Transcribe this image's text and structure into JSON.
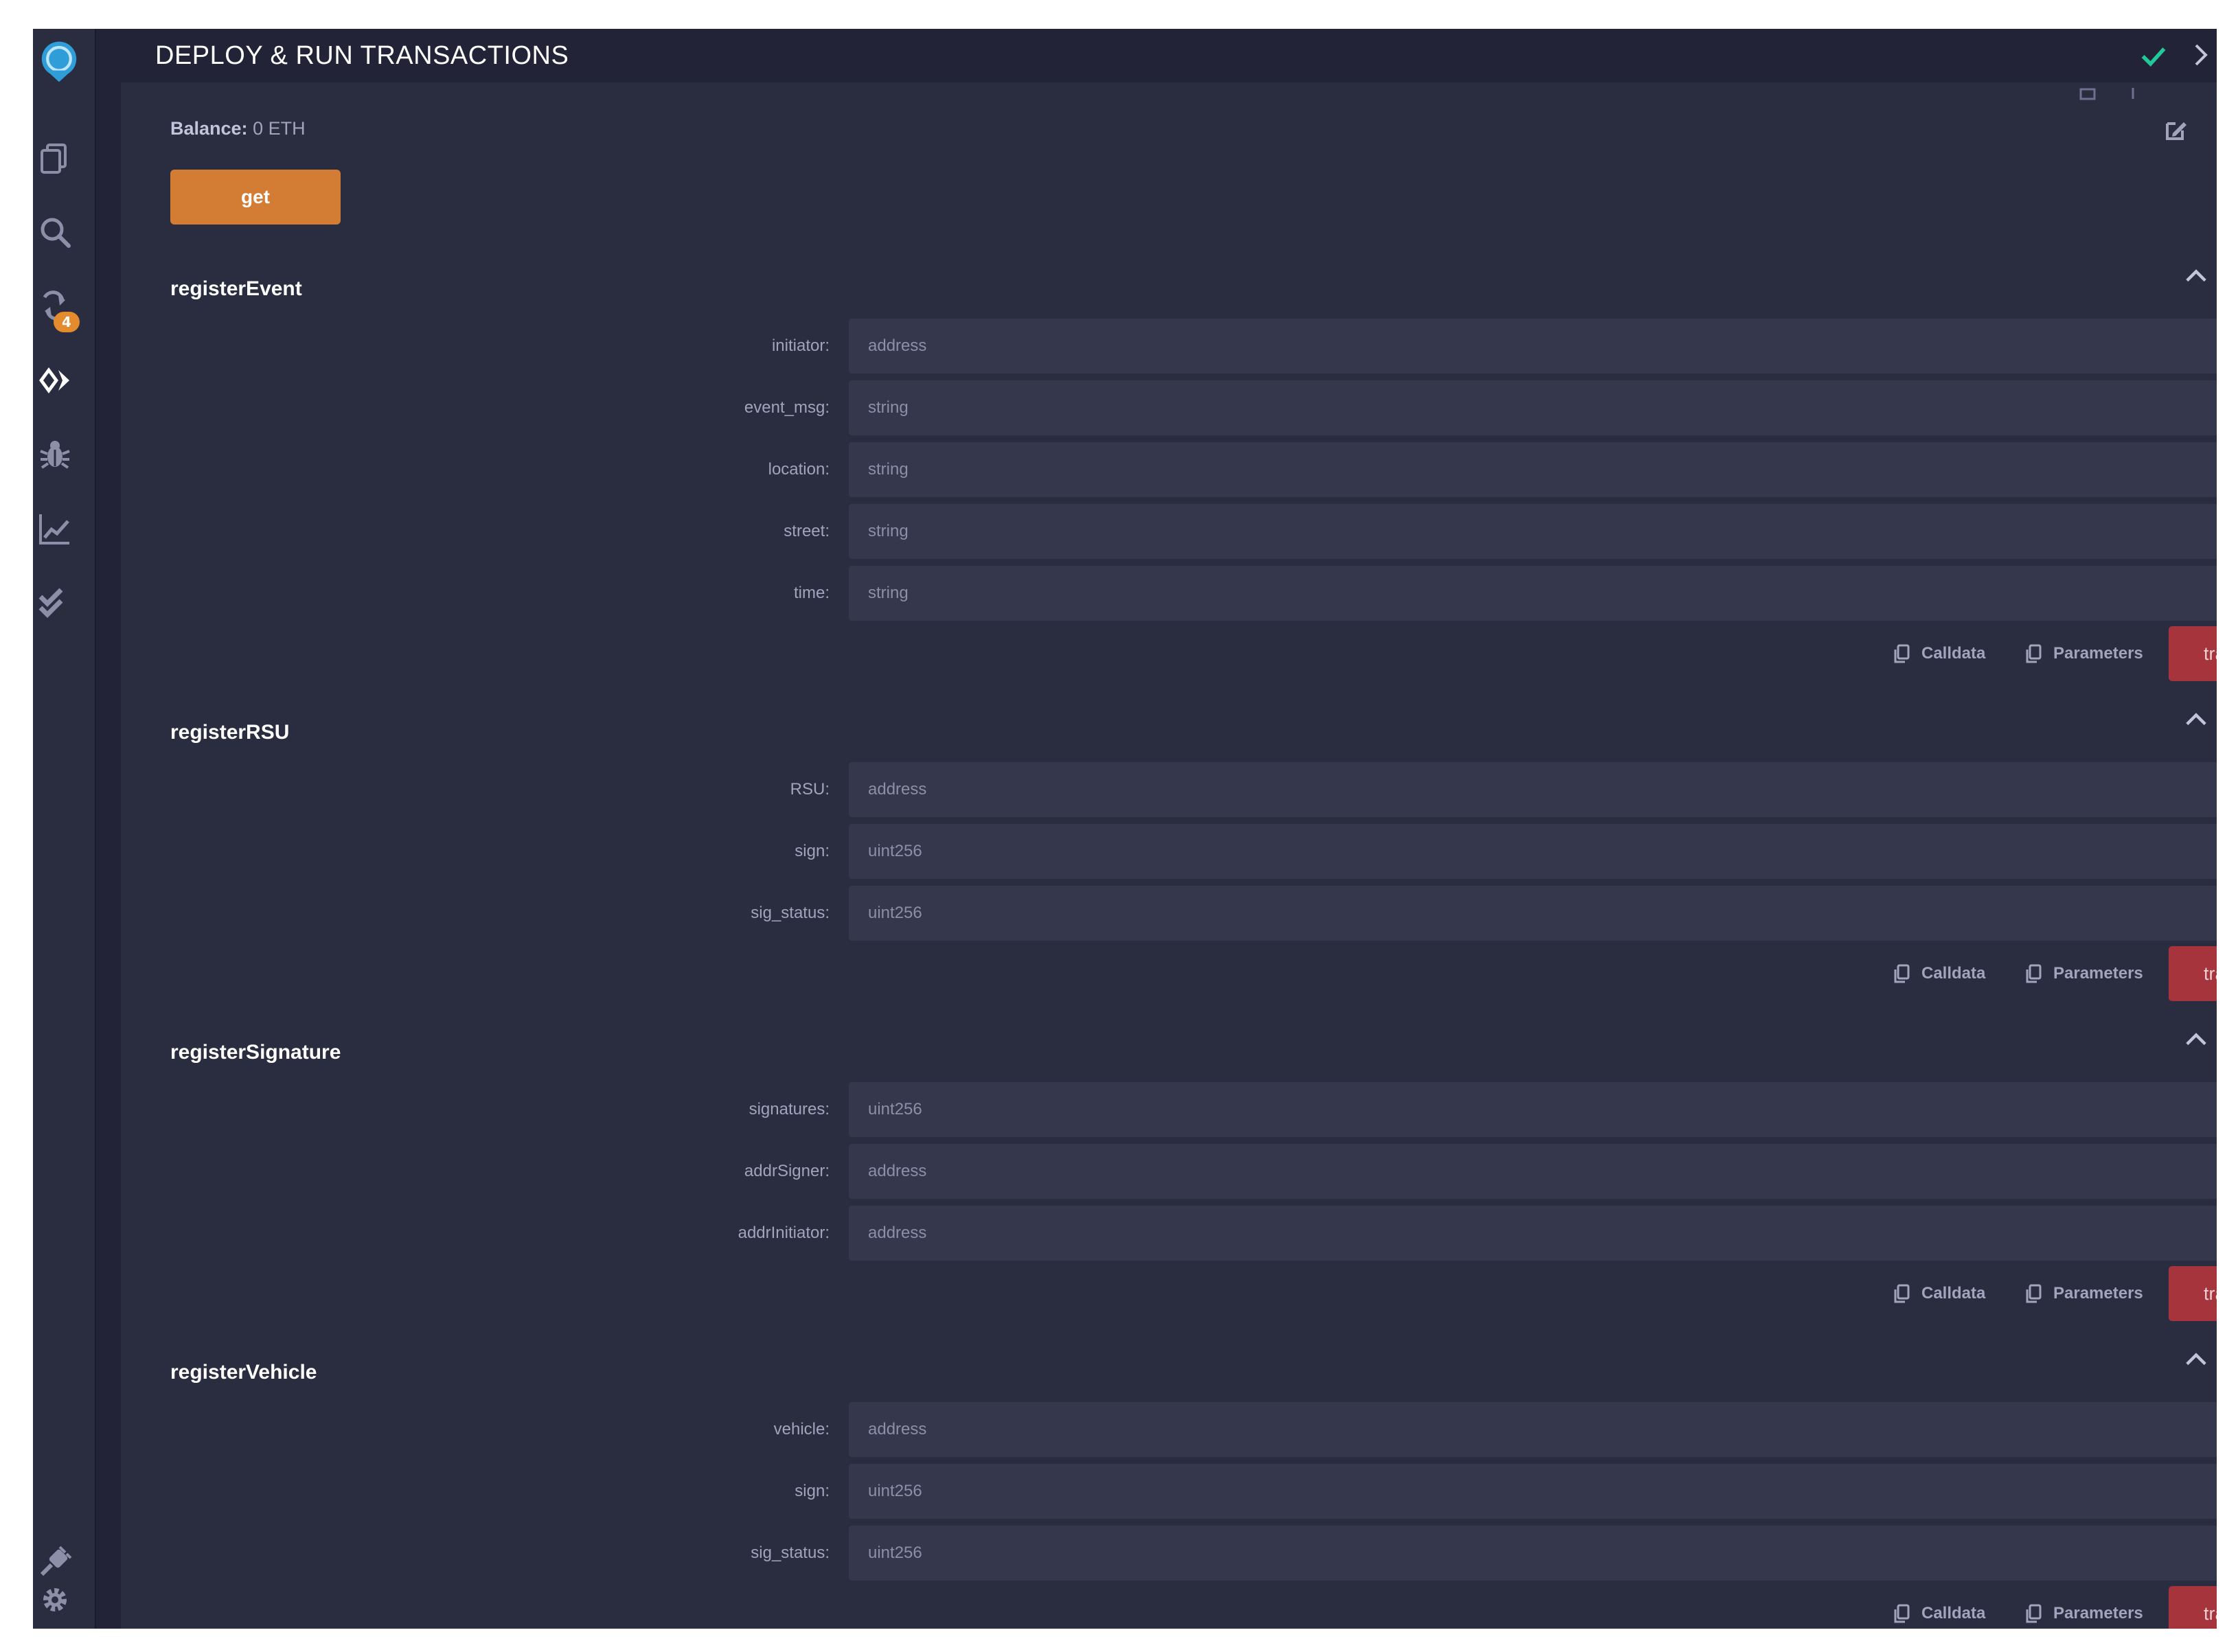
{
  "panel": {
    "title": "DEPLOY & RUN TRANSACTIONS",
    "balance_label": "Balance:",
    "balance_value": "0 ETH",
    "get_label": "get"
  },
  "sidebar": {
    "badge_count": "4"
  },
  "actions": {
    "calldata_label": "Calldata",
    "parameters_label": "Parameters",
    "transact_label": "transact"
  },
  "functions": [
    {
      "name": "registerEvent",
      "params": [
        {
          "label": "initiator:",
          "placeholder": "address"
        },
        {
          "label": "event_msg:",
          "placeholder": "string"
        },
        {
          "label": "location:",
          "placeholder": "string"
        },
        {
          "label": "street:",
          "placeholder": "string"
        },
        {
          "label": "time:",
          "placeholder": "string"
        }
      ]
    },
    {
      "name": "registerRSU",
      "params": [
        {
          "label": "RSU:",
          "placeholder": "address"
        },
        {
          "label": "sign:",
          "placeholder": "uint256"
        },
        {
          "label": "sig_status:",
          "placeholder": "uint256"
        }
      ]
    },
    {
      "name": "registerSignature",
      "params": [
        {
          "label": "signatures:",
          "placeholder": "uint256"
        },
        {
          "label": "addrSigner:",
          "placeholder": "address"
        },
        {
          "label": "addrInitiator:",
          "placeholder": "address"
        }
      ]
    },
    {
      "name": "registerVehicle",
      "params": [
        {
          "label": "vehicle:",
          "placeholder": "address"
        },
        {
          "label": "sign:",
          "placeholder": "uint256"
        },
        {
          "label": "sig_status:",
          "placeholder": "uint256"
        }
      ]
    }
  ],
  "colors": {
    "accent_orange": "#d27c34",
    "transact_red": "#a6343d",
    "status_green": "#20c997",
    "badge_orange": "#e38b2d"
  },
  "icons": {
    "rail": [
      "remix-logo-icon",
      "file-explorer-icon",
      "search-icon",
      "git-icon",
      "deploy-run-icon",
      "debugger-icon",
      "analytics-icon",
      "unit-test-icon",
      "plugin-manager-icon",
      "settings-icon"
    ],
    "header": [
      "checkmark-icon",
      "chevron-right-icon"
    ],
    "panel": [
      "edit-icon",
      "chevron-up-icon",
      "copy-icon"
    ]
  }
}
